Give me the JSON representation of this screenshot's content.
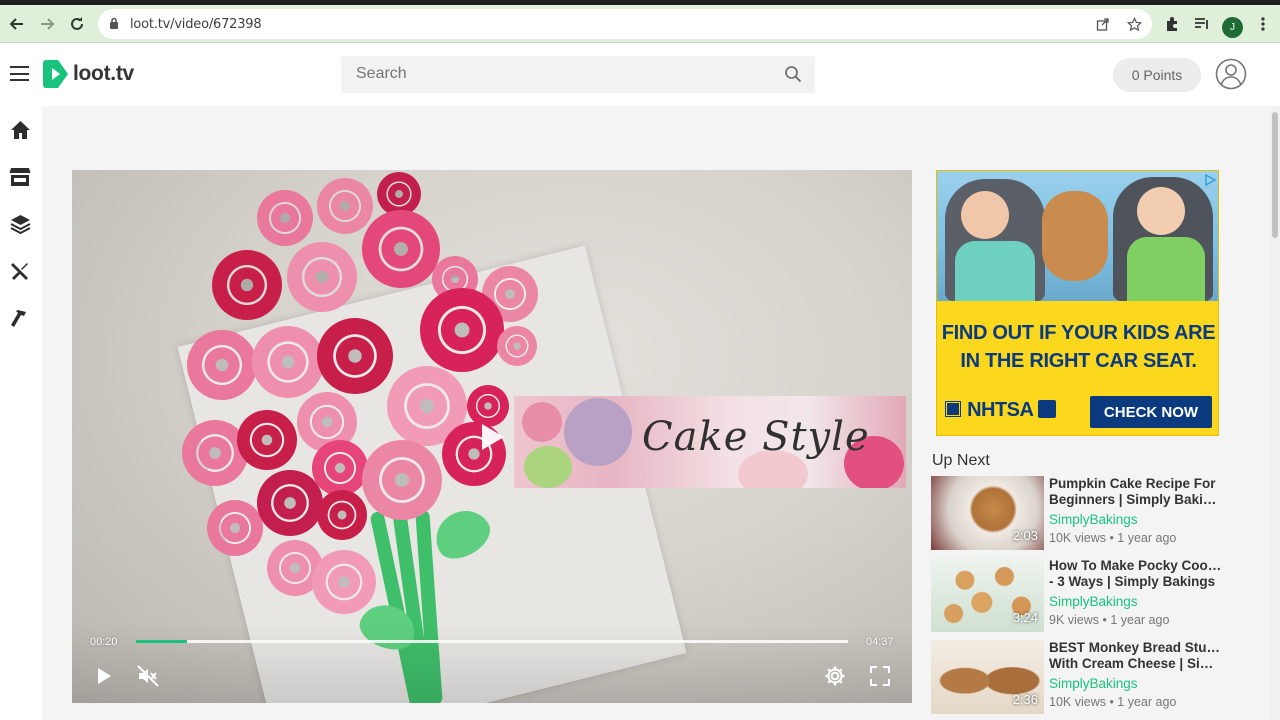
{
  "browser": {
    "url": "loot.tv/video/672398",
    "profile_initial": "J"
  },
  "header": {
    "logo_text": "loot.tv",
    "search_placeholder": "Search",
    "points_label": "0 Points"
  },
  "sidebar": {
    "items": [
      {
        "icon": "home-icon"
      },
      {
        "icon": "store-icon"
      },
      {
        "icon": "layers-icon"
      },
      {
        "icon": "tools-icon"
      },
      {
        "icon": "hammer-icon"
      }
    ]
  },
  "player": {
    "current_time": "00:20",
    "total_time": "04:37",
    "progress_fraction": 0.072,
    "overlay_text": "Cake Style",
    "muted": true
  },
  "ad": {
    "headline_line1": "FIND OUT IF YOUR KIDS ARE",
    "headline_line2": "IN THE RIGHT CAR SEAT.",
    "brand": "NHTSA",
    "cta": "CHECK NOW"
  },
  "up_next": {
    "title": "Up Next",
    "items": [
      {
        "title_line1": "Pumpkin Cake Recipe For",
        "title_line2": "Beginners | Simply Bakings",
        "channel": "SimplyBakings",
        "meta": "10K views • 1 year ago",
        "duration": "2:03"
      },
      {
        "title_line1": "How To Make Pocky Cookies",
        "title_line2": "- 3 Ways | Simply Bakings",
        "channel": "SimplyBakings",
        "meta": "9K views • 1 year ago",
        "duration": "3:24"
      },
      {
        "title_line1": "BEST Monkey Bread Stuffed",
        "title_line2": "With Cream Cheese | Simp...",
        "channel": "SimplyBakings",
        "meta": "10K views • 1 year ago",
        "duration": "2:36"
      }
    ]
  },
  "colors": {
    "accent": "#19c37d",
    "browser_bar": "#dfefd9",
    "ad_yellow": "#fbd71d",
    "ad_blue": "#0b3a7e"
  }
}
